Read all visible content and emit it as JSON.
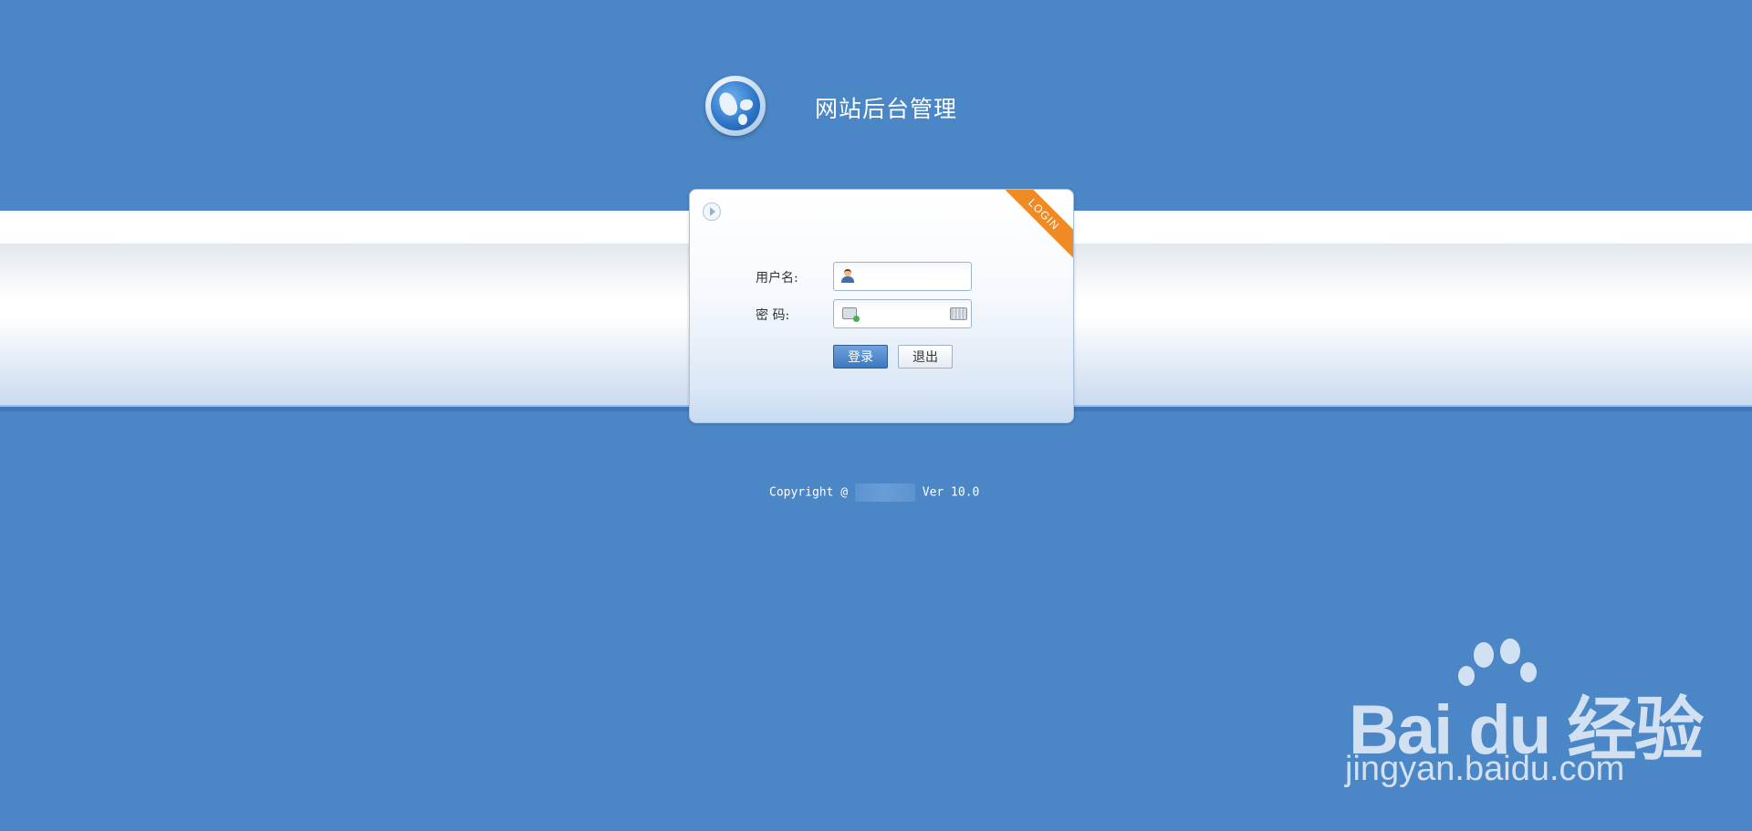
{
  "header": {
    "site_title": "网站后台管理"
  },
  "login": {
    "ribbon_label": "LOGIN",
    "username_label": "用户名:",
    "password_label": "密 码:",
    "username_value": "",
    "password_value": "",
    "login_button": "登录",
    "exit_button": "退出"
  },
  "footer": {
    "copyright_prefix": "Copyright @",
    "version": "Ver 10.0"
  },
  "watermark": {
    "brand": "Bai du 经验",
    "url": "jingyan.baidu.com"
  },
  "colors": {
    "background": "#4b86c6",
    "ribbon": "#f08a22",
    "login_button": "#3d78c0"
  },
  "icons": [
    "globe-logo-icon",
    "play-circle-icon",
    "user-icon",
    "lock-icon",
    "keyboard-icon",
    "baidu-paw-icon"
  ]
}
